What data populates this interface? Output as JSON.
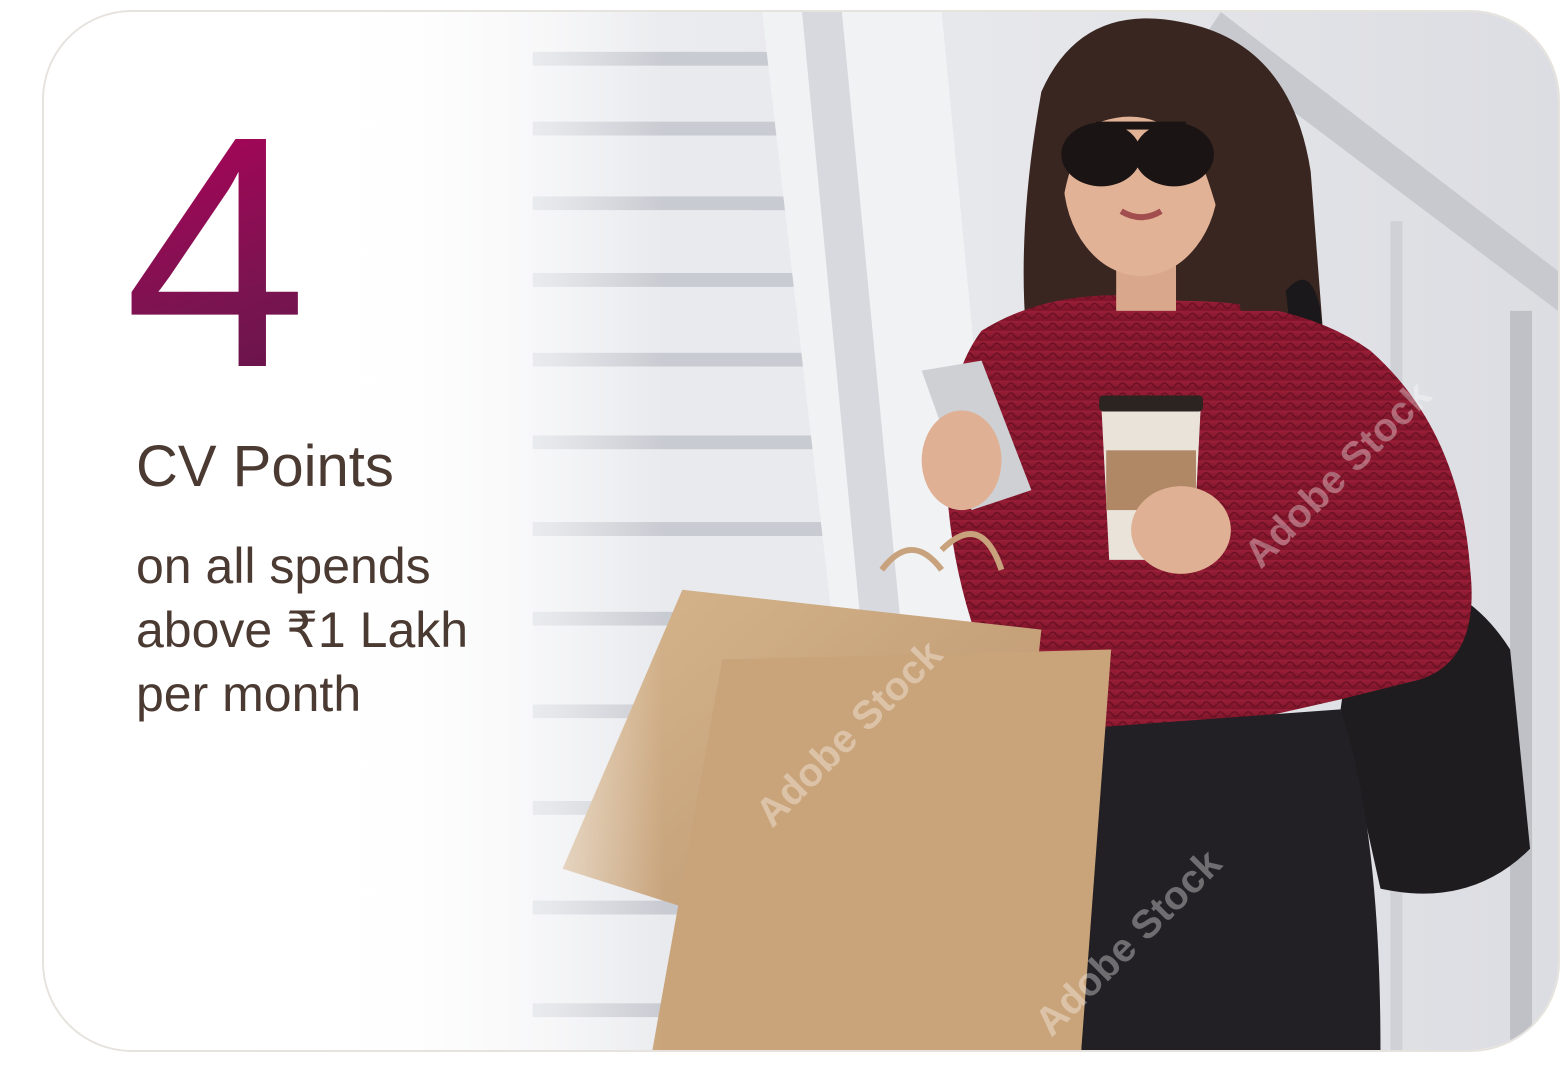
{
  "offer": {
    "number": "4",
    "headline": "CV Points",
    "description_lines": [
      "on all spends",
      "above ₹1 Lakh",
      "per month"
    ]
  },
  "image": {
    "subject": "woman with shopping bags and coffee on stairs",
    "watermark": "Adobe Stock"
  },
  "colors": {
    "accent_gradient_start": "#b3005a",
    "accent_gradient_end": "#5a1448",
    "text": "#4a3a32"
  }
}
